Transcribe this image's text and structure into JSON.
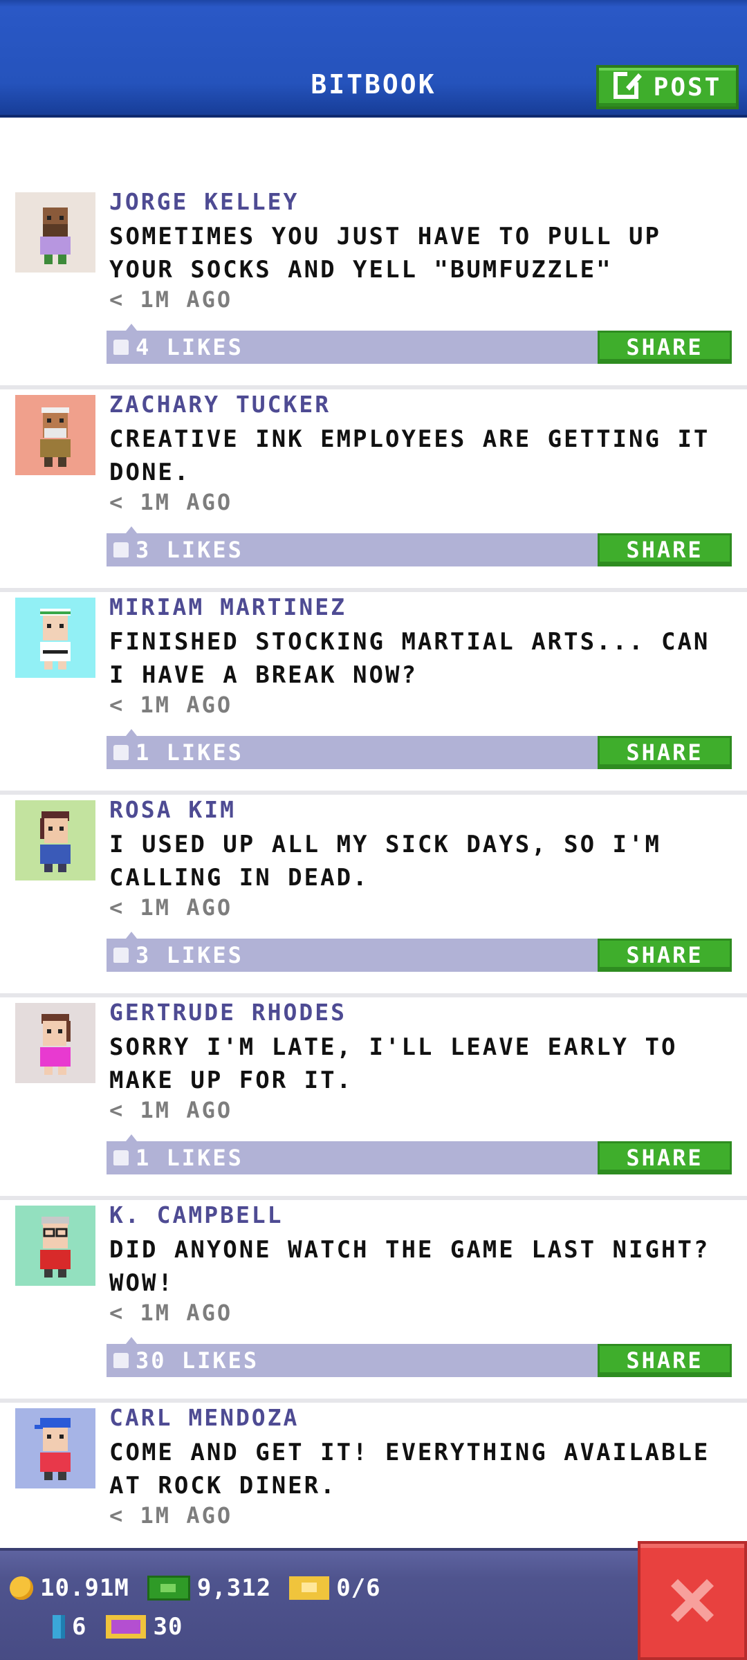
{
  "header": {
    "title": "BITBOOK",
    "post_label": "POST"
  },
  "colors": {
    "header_blue": "#2553bc",
    "name_purple": "#4e4b93",
    "likes_bar": "#b1b2d6",
    "share_green": "#3fae2c",
    "close_red": "#e8413f",
    "bottom_bar": "#4f548e"
  },
  "posts": [
    {
      "name": "JORGE KELLEY",
      "text": "SOMETIMES YOU JUST HAVE TO PULL UP YOUR SOCKS AND YELL \"BUMFUZZLE\"",
      "time": "< 1M AGO",
      "likes": "4 LIKES",
      "share_label": "SHARE",
      "avatar_bg": "#ece3dc"
    },
    {
      "name": "ZACHARY TUCKER",
      "text": "CREATIVE INK EMPLOYEES ARE GETTING IT DONE.",
      "time": "< 1M AGO",
      "likes": "3 LIKES",
      "share_label": "SHARE",
      "avatar_bg": "#f0a08c"
    },
    {
      "name": "MIRIAM MARTINEZ",
      "text": "FINISHED STOCKING MARTIAL ARTS... CAN I HAVE A BREAK NOW?",
      "time": "< 1M AGO",
      "likes": "1 LIKES",
      "share_label": "SHARE",
      "avatar_bg": "#92f0f5"
    },
    {
      "name": "ROSA KIM",
      "text": "I USED UP ALL MY SICK DAYS, SO I'M CALLING IN DEAD.",
      "time": "< 1M AGO",
      "likes": "3 LIKES",
      "share_label": "SHARE",
      "avatar_bg": "#c3e39f"
    },
    {
      "name": "GERTRUDE RHODES",
      "text": "SORRY I'M LATE, I'LL LEAVE EARLY TO MAKE UP FOR IT.",
      "time": "< 1M AGO",
      "likes": "1 LIKES",
      "share_label": "SHARE",
      "avatar_bg": "#e4dcdc"
    },
    {
      "name": "K. CAMPBELL",
      "text": "DID ANYONE WATCH THE GAME LAST NIGHT? WOW!",
      "time": "< 1M AGO",
      "likes": "30 LIKES",
      "share_label": "SHARE",
      "avatar_bg": "#93e0bf"
    },
    {
      "name": "CARL MENDOZA",
      "text": "COME AND GET IT! EVERYTHING AVAILABLE AT ROCK DINER.",
      "time": "< 1M AGO",
      "likes": "",
      "share_label": "",
      "avatar_bg": "#a6b4e6"
    }
  ],
  "stats": {
    "coins": "10.91M",
    "cash": "9,312",
    "tickets": "0/6",
    "bux": "6",
    "vip": "30"
  }
}
